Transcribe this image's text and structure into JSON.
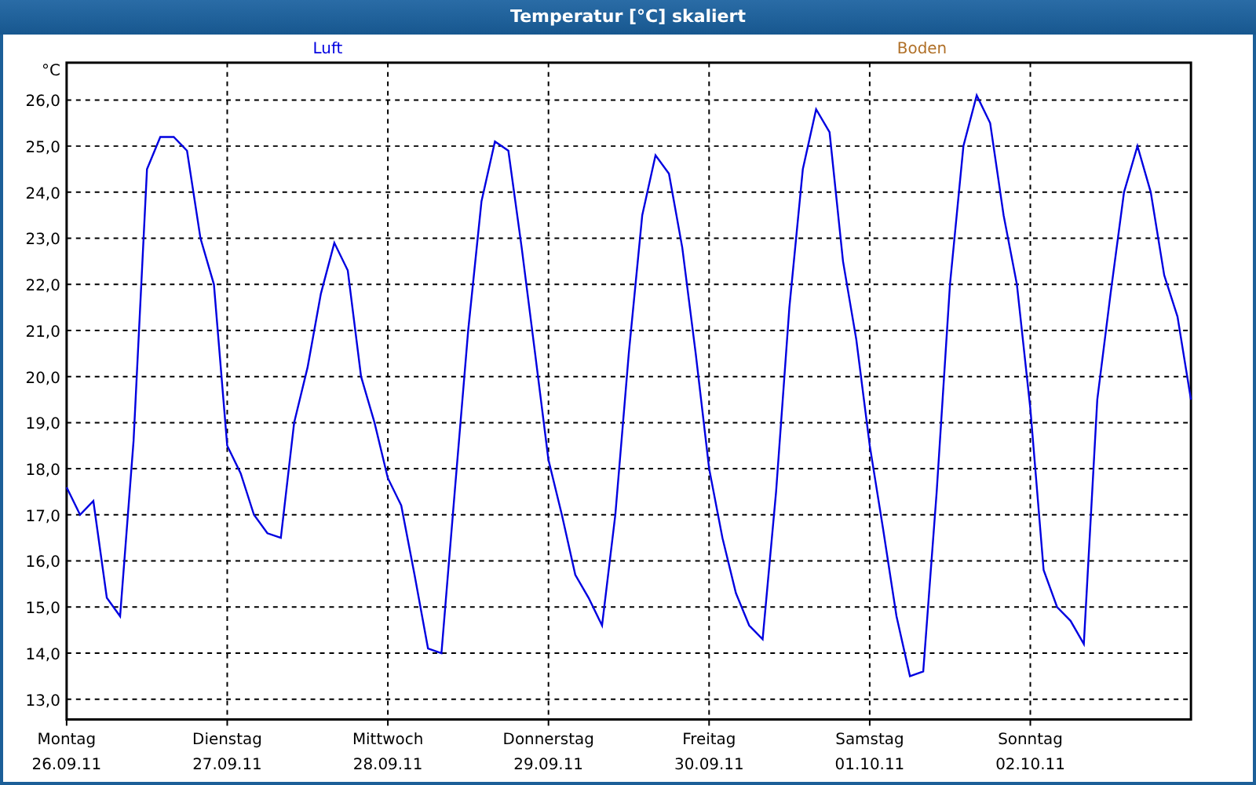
{
  "window": {
    "title": "Temperatur [°C] skaliert"
  },
  "chart": {
    "legend": [
      {
        "label": "Boden",
        "color": "#b07028"
      }
    ],
    "chart_data": {
      "type": "line",
      "grid": true,
      "ylabel": "°C",
      "ylim": [
        12.56,
        26.81
      ],
      "yticks": [
        {
          "value": 13,
          "label": "13,0"
        },
        {
          "value": 14,
          "label": "14,0"
        },
        {
          "value": 15,
          "label": "15,0"
        },
        {
          "value": 16,
          "label": "16,0"
        },
        {
          "value": 17,
          "label": "17,0"
        },
        {
          "value": 18,
          "label": "18,0"
        },
        {
          "value": 19,
          "label": "19,0"
        },
        {
          "value": 20,
          "label": "20,0"
        },
        {
          "value": 21,
          "label": "21,0"
        },
        {
          "value": 22,
          "label": "22,0"
        },
        {
          "value": 23,
          "label": "23,0"
        },
        {
          "value": 24,
          "label": "24,0"
        },
        {
          "value": 25,
          "label": "25,0"
        },
        {
          "value": 26,
          "label": "26,0"
        }
      ],
      "categories": [
        "Montag\n26.09.11",
        null,
        null,
        null,
        null,
        null,
        null,
        null,
        null,
        null,
        null,
        null,
        "Dienstag\n27.09.11",
        null,
        null,
        null,
        null,
        null,
        null,
        null,
        null,
        null,
        null,
        null,
        "Mittwoch\n28.09.11",
        null,
        null,
        null,
        null,
        null,
        null,
        null,
        null,
        null,
        null,
        null,
        "Donnerstag\n29.09.11",
        null,
        null,
        null,
        null,
        null,
        null,
        null,
        null,
        null,
        null,
        null,
        "Freitag\n30.09.11",
        null,
        null,
        null,
        null,
        null,
        null,
        null,
        null,
        null,
        null,
        null,
        "Samstag\n01.10.11",
        null,
        null,
        null,
        null,
        null,
        null,
        null,
        null,
        null,
        null,
        null,
        "Sonntag\n02.10.11",
        null,
        null,
        null,
        null,
        null,
        null,
        null,
        null,
        null,
        null,
        null,
        null
      ],
      "series": [
        {
          "name": "Luft",
          "color": "#0000e0",
          "values": [
            17.6,
            17.0,
            17.3,
            15.2,
            14.8,
            18.6,
            24.5,
            25.2,
            25.2,
            24.9,
            23.0,
            22.0,
            18.5,
            17.9,
            17.0,
            16.6,
            16.5,
            19.0,
            20.2,
            21.8,
            22.9,
            22.3,
            20.0,
            19.0,
            17.8,
            17.2,
            15.7,
            14.1,
            14.0,
            17.5,
            21.0,
            23.8,
            25.1,
            24.9,
            22.8,
            20.5,
            18.2,
            17.0,
            15.7,
            15.2,
            14.6,
            17.0,
            20.5,
            23.5,
            24.8,
            24.4,
            22.8,
            20.5,
            18.0,
            16.5,
            15.3,
            14.6,
            14.3,
            17.5,
            21.5,
            24.5,
            25.8,
            25.3,
            22.5,
            20.8,
            18.5,
            16.7,
            14.8,
            13.5,
            13.6,
            17.5,
            22.0,
            25.0,
            26.1,
            25.5,
            23.5,
            22.0,
            19.3,
            15.8,
            15.0,
            14.7,
            14.2,
            19.5,
            21.8,
            24.0,
            25.0,
            24.0,
            22.2,
            21.3,
            19.5
          ]
        }
      ]
    }
  }
}
